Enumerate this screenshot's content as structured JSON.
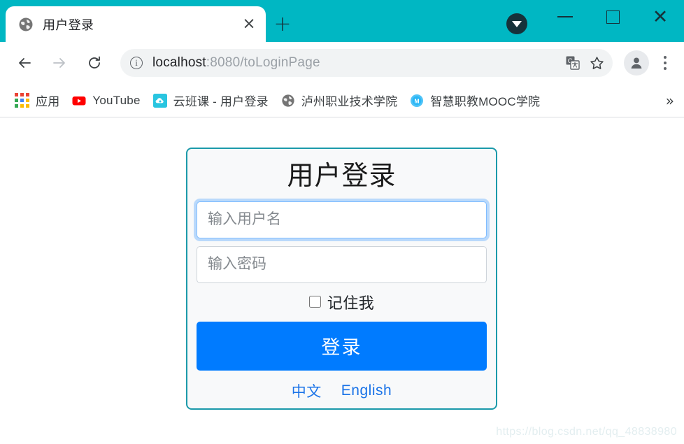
{
  "window": {
    "chrome_bg": "#00b7c3",
    "controls": {
      "minimize": "minimize-button",
      "maximize": "maximize-button",
      "close": "close-button"
    },
    "tab_search_label": "Search tabs"
  },
  "tabs": [
    {
      "title": "用户登录",
      "favicon": "globe-icon",
      "active": true,
      "close_label": "×"
    }
  ],
  "new_tab_label": "+",
  "toolbar": {
    "back_label": "←",
    "forward_label": "→",
    "reload_label": "⟳",
    "info_label": "i",
    "url_host": "localhost",
    "url_path": ":8080/toLoginPage",
    "url_full": "localhost:8080/toLoginPage",
    "translate_icon": "translate-icon",
    "bookmark_icon": "star-icon",
    "profile_icon": "profile-avatar-icon",
    "menu_icon": "three-dot-menu-icon"
  },
  "bookmarks": {
    "items": [
      {
        "label": "应用",
        "icon": "apps-grid-icon"
      },
      {
        "label": "YouTube",
        "icon": "youtube-icon"
      },
      {
        "label": "云班课 - 用户登录",
        "icon": "cloud-class-icon"
      },
      {
        "label": "泸州职业技术学院",
        "icon": "globe-icon"
      },
      {
        "label": "智慧职教MOOC学院",
        "icon": "mooc-m-icon"
      }
    ],
    "overflow_label": "»"
  },
  "login_card": {
    "border_color": "#1b9aaa",
    "background": "#f8f9fa",
    "title": "用户登录",
    "username": {
      "placeholder": "输入用户名",
      "value": "",
      "focused": true
    },
    "password": {
      "placeholder": "输入密码",
      "value": "",
      "focused": false
    },
    "remember": {
      "label": "记住我",
      "checked": false
    },
    "submit": {
      "label": "登录",
      "color": "#007bff"
    },
    "languages": [
      {
        "label": "中文",
        "color": "#1a73e8"
      },
      {
        "label": "English",
        "color": "#1a73e8"
      }
    ]
  },
  "watermark": "https://blog.csdn.net/qq_48838980"
}
